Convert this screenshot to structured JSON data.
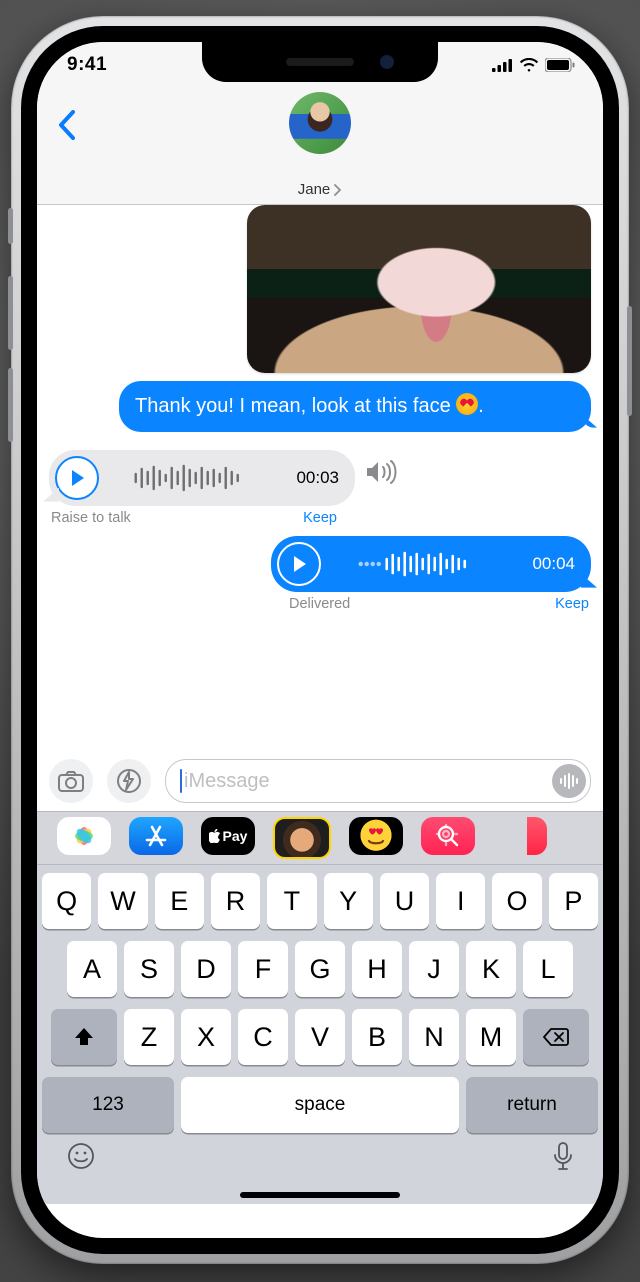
{
  "status": {
    "time": "9:41"
  },
  "header": {
    "contact_name": "Jane"
  },
  "messages": {
    "sent_text": "Thank you! I mean, look at this face ",
    "sent_text_after": ".",
    "audio_recv": {
      "duration": "00:03",
      "hint": "Raise to talk",
      "keep": "Keep"
    },
    "audio_sent": {
      "duration": "00:04",
      "status": "Delivered",
      "keep": "Keep"
    }
  },
  "composer": {
    "placeholder": "iMessage"
  },
  "apps": {
    "pay_label": "Pay"
  },
  "keyboard": {
    "row1": [
      "Q",
      "W",
      "E",
      "R",
      "T",
      "Y",
      "U",
      "I",
      "O",
      "P"
    ],
    "row2": [
      "A",
      "S",
      "D",
      "F",
      "G",
      "H",
      "J",
      "K",
      "L"
    ],
    "row3": [
      "Z",
      "X",
      "C",
      "V",
      "B",
      "N",
      "M"
    ],
    "numbers": "123",
    "space": "space",
    "return": "return"
  }
}
